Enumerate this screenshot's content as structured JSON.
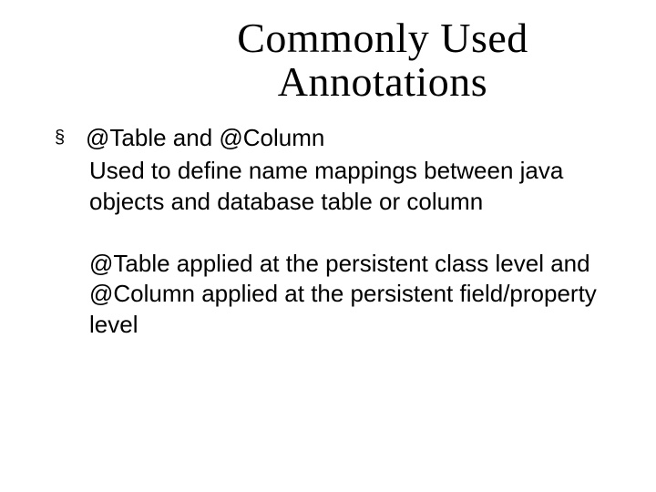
{
  "title": "Commonly Used Annotations",
  "bullet_glyph": "§",
  "item": {
    "heading": "@Table and @Column",
    "para1": "Used to define name mappings between java objects and database table or column",
    "para2": "@Table applied at the persistent class level and @Column applied at the  persistent field/property level"
  }
}
